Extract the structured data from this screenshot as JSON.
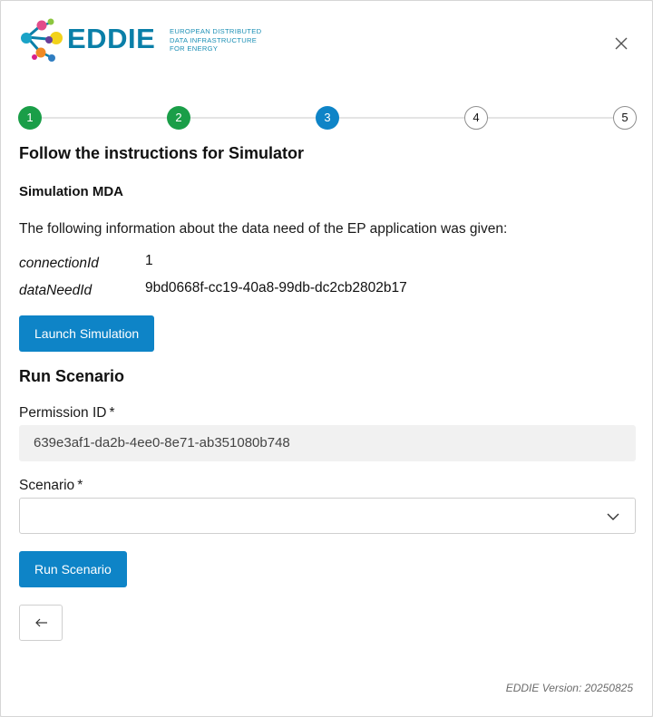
{
  "header": {
    "logo_word": "EDDIE",
    "logo_tagline": [
      "EUROPEAN DISTRIBUTED",
      "DATA INFRASTRUCTURE",
      "FOR ENERGY"
    ]
  },
  "stepper": {
    "steps": [
      {
        "label": "1",
        "state": "done"
      },
      {
        "label": "2",
        "state": "done"
      },
      {
        "label": "3",
        "state": "active"
      },
      {
        "label": "4",
        "state": "todo"
      },
      {
        "label": "5",
        "state": "todo"
      }
    ],
    "colors": {
      "done": "#1a9e48",
      "active": "#0e84c7",
      "line": "#e4e4e4"
    }
  },
  "content": {
    "title": "Follow the instructions for Simulator",
    "subtitle": "Simulation MDA",
    "info_text": "The following information about the data need of the EP application was given:",
    "fields": [
      {
        "key": "connectionId",
        "value": "1"
      },
      {
        "key": "dataNeedId",
        "value": "9bd0668f-cc19-40a8-99db-dc2cb2802b17"
      }
    ],
    "launch_button": "Launch Simulation"
  },
  "run_scenario": {
    "title": "Run Scenario",
    "permission_label": "Permission ID",
    "permission_value": "639e3af1-da2b-4ee0-8e71-ab351080b748",
    "scenario_label": "Scenario",
    "scenario_value": "",
    "required_mark": "*",
    "run_button": "Run Scenario"
  },
  "footer": {
    "version": "EDDIE Version: 20250825"
  },
  "accent_color": "#0e84c7"
}
